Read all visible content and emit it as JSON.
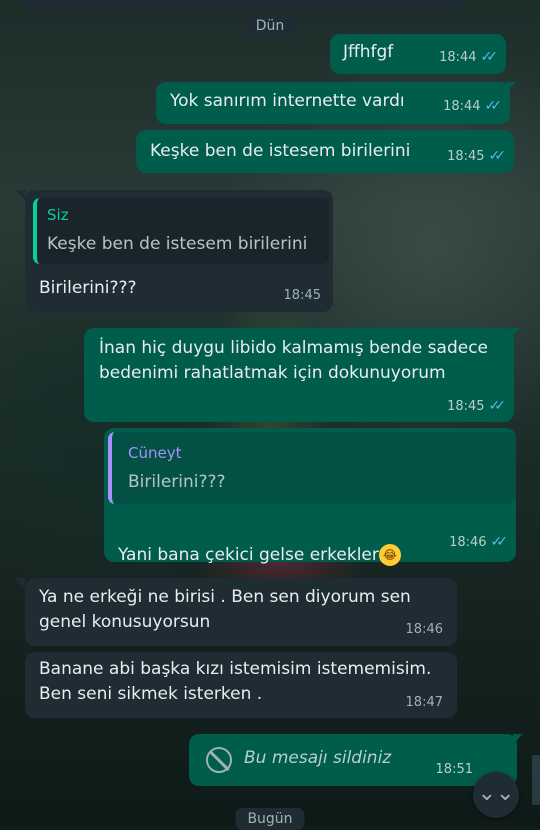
{
  "date_chips": {
    "yesterday": "Dün",
    "today": "Bugün"
  },
  "messages": [
    {
      "direction": "out",
      "text": "Jffhfgf",
      "time": "18:44",
      "status": "read"
    },
    {
      "direction": "out",
      "text": "Yok sanırım internette vardı",
      "time": "18:44",
      "status": "read"
    },
    {
      "direction": "out",
      "text": "Keşke ben de istesem birilerini",
      "time": "18:45",
      "status": "read"
    },
    {
      "direction": "in",
      "quote": {
        "author": "Siz",
        "text": "Keşke ben de istesem birilerini"
      },
      "text": "Birilerini???",
      "time": "18:45"
    },
    {
      "direction": "out",
      "text": "İnan hiç duygu libido kalmamış bende sadece\nbedenimi rahatlatmak için dokunuyorum",
      "time": "18:45",
      "status": "read"
    },
    {
      "direction": "out",
      "quote": {
        "author": "Cüneyt",
        "text": "Birilerini???"
      },
      "text": "Yani bana çekici gelse erkekler",
      "emoji": "joy-emoji",
      "time": "18:46",
      "status": "read"
    },
    {
      "direction": "in",
      "text": "Ya ne erkeği ne birisi . Ben sen diyorum sen\ngenel konusuyorsun",
      "time": "18:46"
    },
    {
      "direction": "in",
      "text": "Banane abi başka kızı istemisim istememisim.\nBen seni sikmek isterken .",
      "time": "18:47"
    },
    {
      "direction": "out",
      "deleted": true,
      "text": "Bu mesajı sildiniz",
      "time": "18:51",
      "icon": "blocked-icon"
    }
  ],
  "colors": {
    "outgoing_bubble": "#005c4b",
    "incoming_bubble": "#202c33",
    "read_tick": "#53bdeb",
    "quote_self": "#06cf9c",
    "quote_other": "#a791ff"
  },
  "scroll_button": {
    "icon": "chevron-double-down-icon",
    "glyph": "⌄⌄"
  }
}
